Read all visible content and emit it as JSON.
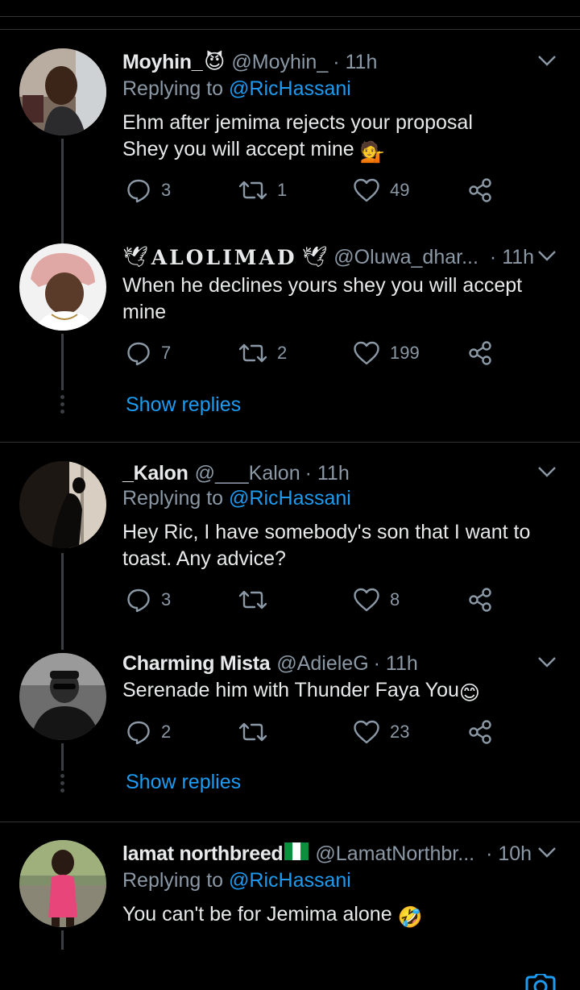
{
  "tweets": [
    {
      "name": "Moyhin_",
      "name_emoji": "😈",
      "handle": "@Moyhin_",
      "time": "· 11h",
      "replying_prefix": "Replying to ",
      "replying_to": "@RicHassani",
      "text_line1": "Ehm after jemima rejects your proposal",
      "text_line2": "Shey you will accept mine",
      "text_emoji": "💁",
      "replies": "3",
      "retweets": "1",
      "likes": "49"
    },
    {
      "name": "ALOLIMAD",
      "name_prefix_emoji": "🕊",
      "name_suffix_emoji": "🕊",
      "handle": "@Oluwa_dhar...",
      "time": "· 11h",
      "text_line1": "When he declines yours shey you will accept",
      "text_line2": "mine",
      "replies": "7",
      "retweets": "2",
      "likes": "199",
      "show_replies": "Show replies"
    },
    {
      "name": "_Kalon",
      "handle": "@___Kalon",
      "time": "· 11h",
      "replying_prefix": "Replying to ",
      "replying_to": "@RicHassani",
      "text_line1": "Hey Ric, I have somebody's son that I want to",
      "text_line2": "toast. Any advice?",
      "replies": "3",
      "retweets": "",
      "likes": "8"
    },
    {
      "name": "Charming Mista",
      "handle": "@AdieleG",
      "time": "· 11h",
      "text_line1": "Serenade him with Thunder Faya You",
      "text_emoji": "😊",
      "replies": "2",
      "retweets": "",
      "likes": "23",
      "show_replies": "Show replies"
    },
    {
      "name": "lamat northbreed",
      "name_emoji": "🇳🇬",
      "handle": "@LamatNorthbr...",
      "time": "· 10h",
      "replying_prefix": "Replying to ",
      "replying_to": "@RicHassani",
      "text_line1": "You can't be for Jemima alone",
      "text_emoji": "🤣"
    }
  ],
  "colors": {
    "background": "#000000",
    "text": "#e7e9ea",
    "secondary": "#8b98a5",
    "link": "#1d9bf0",
    "divider": "#2f3336"
  },
  "icons": [
    "chevron-down-icon",
    "reply-icon",
    "retweet-icon",
    "like-icon",
    "share-icon",
    "camera-icon"
  ]
}
